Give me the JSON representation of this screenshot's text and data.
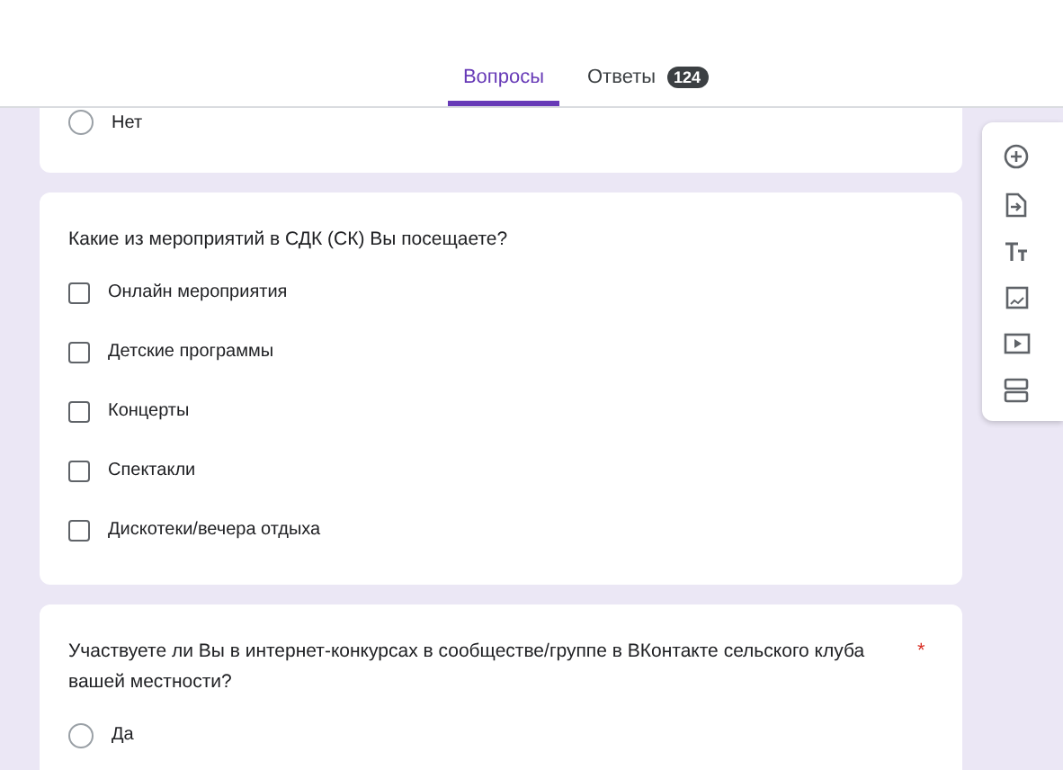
{
  "tabs": [
    {
      "label": "Вопросы",
      "selected": true
    },
    {
      "label": "Ответы",
      "selected": false,
      "badge": "124"
    }
  ],
  "questions": [
    {
      "kind": "radio",
      "options": [
        {
          "label": "Нет",
          "checked": false
        }
      ]
    },
    {
      "kind": "checkbox",
      "title": "Какие из мероприятий в СДК (СК) Вы посещаете?",
      "options": [
        {
          "label": "Онлайн мероприятия",
          "checked": false
        },
        {
          "label": "Детские программы",
          "checked": false
        },
        {
          "label": "Концерты",
          "checked": false
        },
        {
          "label": "Спектакли",
          "checked": false
        },
        {
          "label": "Дискотеки/вечера отдыха",
          "checked": false
        }
      ]
    },
    {
      "kind": "radio",
      "title": "Участвуете ли Вы в интернет-конкурсах в сообществе/группе в ВКонтакте сельского клуба вашей местности?",
      "required_mark": "*",
      "options": [
        {
          "label": "Да",
          "checked": false
        }
      ]
    }
  ]
}
